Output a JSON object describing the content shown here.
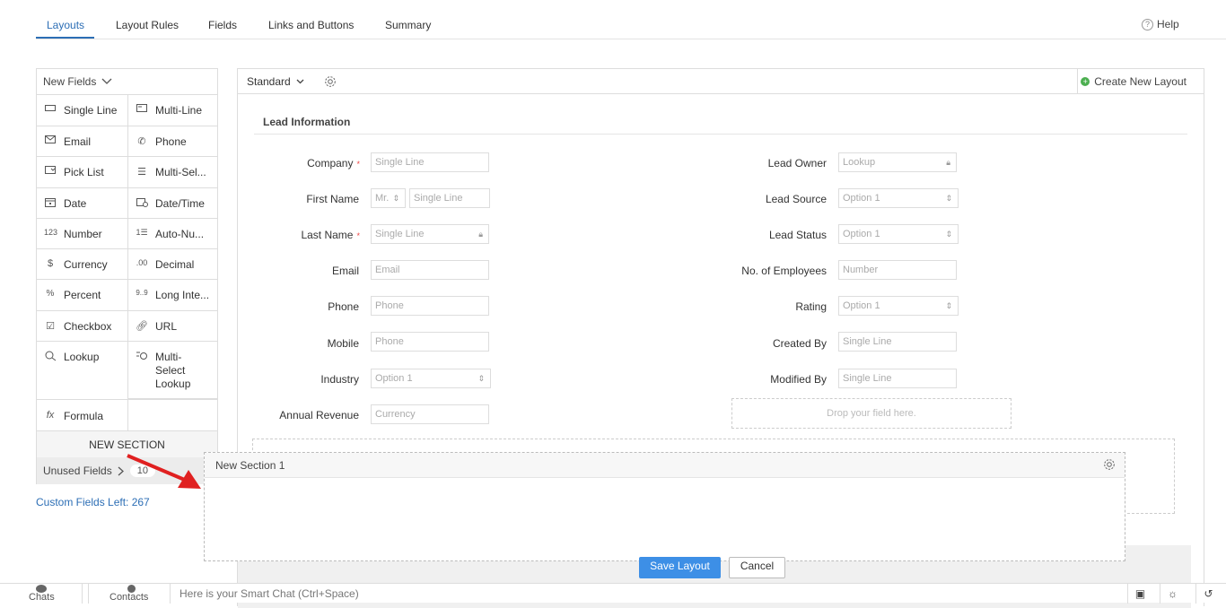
{
  "tabs": [
    {
      "label": "Layouts",
      "active": true
    },
    {
      "label": "Layout Rules"
    },
    {
      "label": "Fields"
    },
    {
      "label": "Links and Buttons"
    },
    {
      "label": "Summary"
    }
  ],
  "help_label": "Help",
  "palette": {
    "header": "New Fields",
    "fields": [
      {
        "label": "Single Line",
        "icon": "single-line-icon"
      },
      {
        "label": "Multi-Line",
        "icon": "multi-line-icon"
      },
      {
        "label": "Email",
        "icon": "email-icon"
      },
      {
        "label": "Phone",
        "icon": "phone-icon"
      },
      {
        "label": "Pick List",
        "icon": "pick-list-icon"
      },
      {
        "label": "Multi-Sel...",
        "icon": "multi-select-icon"
      },
      {
        "label": "Date",
        "icon": "date-icon"
      },
      {
        "label": "Date/Time",
        "icon": "date-time-icon"
      },
      {
        "label": "Number",
        "icon": "number-icon"
      },
      {
        "label": "Auto-Nu...",
        "icon": "auto-number-icon"
      },
      {
        "label": "Currency",
        "icon": "currency-icon"
      },
      {
        "label": "Decimal",
        "icon": "decimal-icon"
      },
      {
        "label": "Percent",
        "icon": "percent-icon"
      },
      {
        "label": "Long Inte...",
        "icon": "long-integer-icon"
      },
      {
        "label": "Checkbox",
        "icon": "checkbox-icon"
      },
      {
        "label": "URL",
        "icon": "url-icon"
      },
      {
        "label": "Lookup",
        "icon": "lookup-icon"
      },
      {
        "label": "Multi-\nSelect\nLookup",
        "icon": "multi-select-lookup-icon"
      },
      {
        "label": "Formula",
        "icon": "formula-icon"
      }
    ],
    "new_section": "NEW SECTION",
    "unused_fields": "Unused Fields",
    "unused_count": "10",
    "custom_fields_left": "Custom Fields Left: 267"
  },
  "canvas": {
    "layout_name": "Standard",
    "create_new_layout": "Create New Layout",
    "section_title": "Lead Information",
    "left_fields": [
      {
        "label": "Company",
        "required": true,
        "placeholder": "Single Line",
        "type": "text"
      },
      {
        "label": "First Name",
        "required": false,
        "prefix": "Mr.",
        "placeholder": "Single Line",
        "type": "name"
      },
      {
        "label": "Last Name",
        "required": true,
        "placeholder": "Single Line",
        "type": "locked"
      },
      {
        "label": "Email",
        "required": false,
        "placeholder": "Email",
        "type": "text"
      },
      {
        "label": "Phone",
        "required": false,
        "placeholder": "Phone",
        "type": "text"
      },
      {
        "label": "Mobile",
        "required": false,
        "placeholder": "Phone",
        "type": "text"
      },
      {
        "label": "Industry",
        "required": false,
        "placeholder": "Option 1",
        "type": "select"
      },
      {
        "label": "Annual Revenue",
        "required": false,
        "placeholder": "Currency",
        "type": "text"
      }
    ],
    "right_fields": [
      {
        "label": "Lead Owner",
        "placeholder": "Lookup",
        "type": "locked"
      },
      {
        "label": "Lead Source",
        "placeholder": "Option 1",
        "type": "select"
      },
      {
        "label": "Lead Status",
        "placeholder": "Option 1",
        "type": "select"
      },
      {
        "label": "No. of Employees",
        "placeholder": "Number",
        "type": "text"
      },
      {
        "label": "Rating",
        "placeholder": "Option 1",
        "type": "select"
      },
      {
        "label": "Created By",
        "placeholder": "Single Line",
        "type": "text"
      },
      {
        "label": "Modified By",
        "placeholder": "Single Line",
        "type": "text"
      }
    ],
    "drop_hint": "Drop your field here.",
    "new_section_title": "New Section 1",
    "save_label": "Save Layout",
    "cancel_label": "Cancel"
  },
  "bottom_bar": {
    "chats": "Chats",
    "contacts": "Contacts",
    "smart_chat_placeholder": "Here is your Smart Chat (Ctrl+Space)"
  },
  "colors": {
    "accent": "#2c6eb5",
    "save_button": "#3d8fe6",
    "arrow": "#e02020",
    "create_dot": "#4caf50"
  }
}
